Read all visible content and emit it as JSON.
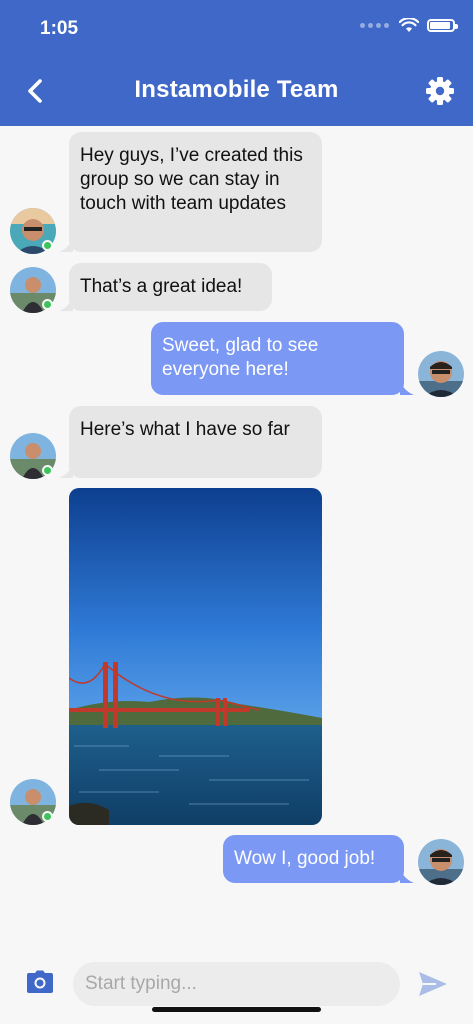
{
  "status_bar": {
    "time": "1:05"
  },
  "header": {
    "title": "Instamobile Team"
  },
  "messages": [
    {
      "direction": "in",
      "text": "Hey guys, I’ve created this group so we can stay in touch with team updates"
    },
    {
      "direction": "in",
      "text": "That’s a great idea!"
    },
    {
      "direction": "out",
      "text": "Sweet, glad to see everyone here!"
    },
    {
      "direction": "in",
      "text": "Here’s what I have so far"
    },
    {
      "direction": "in",
      "type": "image"
    },
    {
      "direction": "out",
      "text": "Wow I, good job!"
    }
  ],
  "composer": {
    "placeholder": "Start typing..."
  },
  "colors": {
    "header": "#3f68c8",
    "outgoing_bubble": "#7b98f5",
    "incoming_bubble": "#e6e6e6",
    "online": "#3cc35a"
  }
}
